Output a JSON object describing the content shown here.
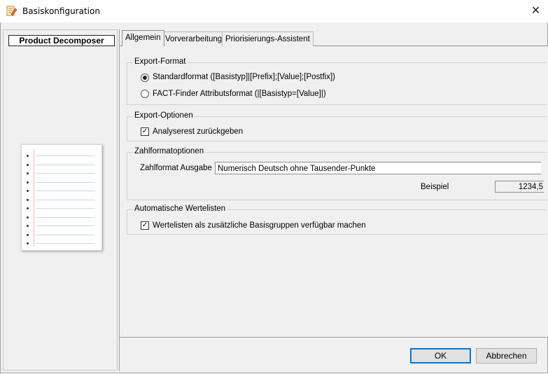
{
  "window": {
    "title": "Basiskonfiguration",
    "close_glyph": "✕"
  },
  "left_panel": {
    "product_label": "Product Decomposer"
  },
  "tabs": [
    {
      "label": "Allgemein",
      "active": true
    },
    {
      "label": "Vorverarbeitung",
      "active": false
    },
    {
      "label": "Priorisierungs-Assistent",
      "active": false
    }
  ],
  "export_format": {
    "legend": "Export-Format",
    "options": [
      {
        "label": "Standardformat ([Basistyp]|[Prefix];[Value];[Postfix])",
        "selected": true
      },
      {
        "label": "FACT-Finder Attributsformat (|[Basistyp=[Value]|)",
        "selected": false
      }
    ]
  },
  "export_optionen": {
    "legend": "Export-Optionen",
    "analyserest": {
      "label": "Analyserest zurückgeben",
      "checked": true
    }
  },
  "zahlformat": {
    "legend": "Zahlformatoptionen",
    "ausgabe_label": "Zahlformat Ausgabe",
    "ausgabe_value": "Numerisch Deutsch ohne Tausender-Punkte",
    "beispiel_label": "Beispiel",
    "beispiel_value": "1234,5"
  },
  "wertelisten": {
    "legend": "Automatische Wertelisten",
    "option": {
      "label": "Wertelisten als zusätzliche Basisgruppen verfügbar machen",
      "checked": true
    }
  },
  "buttons": {
    "ok": "OK",
    "cancel": "Abbrechen"
  },
  "colors": {
    "frame": "#a0a0a0",
    "panel": "#f0f0f0",
    "ok_border": "#0078d7"
  }
}
